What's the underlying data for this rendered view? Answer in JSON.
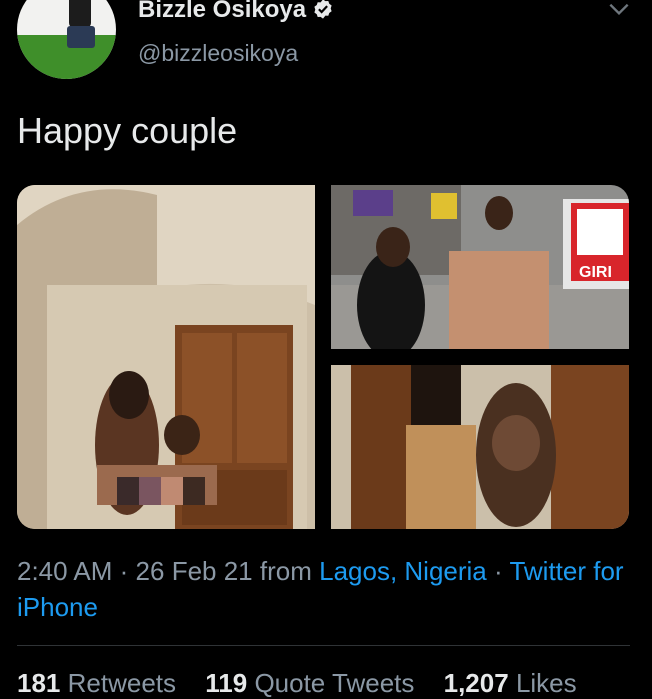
{
  "tweet": {
    "author_name": "Bizzle Osikoya",
    "author_handle": "@bizzleosikoya",
    "text": "Happy couple",
    "time": "2:40 AM",
    "date": "26 Feb 21",
    "from_label": "from",
    "location": "Lagos, Nigeria",
    "client": "Twitter for iPhone",
    "sep": "·"
  },
  "stats": {
    "retweets_count": "181",
    "retweets_label": "Retweets",
    "quotes_count": "119",
    "quotes_label": "Quote Tweets",
    "likes_count": "1,207",
    "likes_label": "Likes"
  },
  "photos": {
    "store_sign": "GIRI"
  },
  "colors": {
    "background": "#000000",
    "text": "#e7e9ea",
    "secondary": "#8b98a5",
    "link": "#1d9bf0",
    "verified": "#e7e9ea"
  },
  "icons": [
    "verified-badge-icon",
    "chevron-down-icon"
  ]
}
